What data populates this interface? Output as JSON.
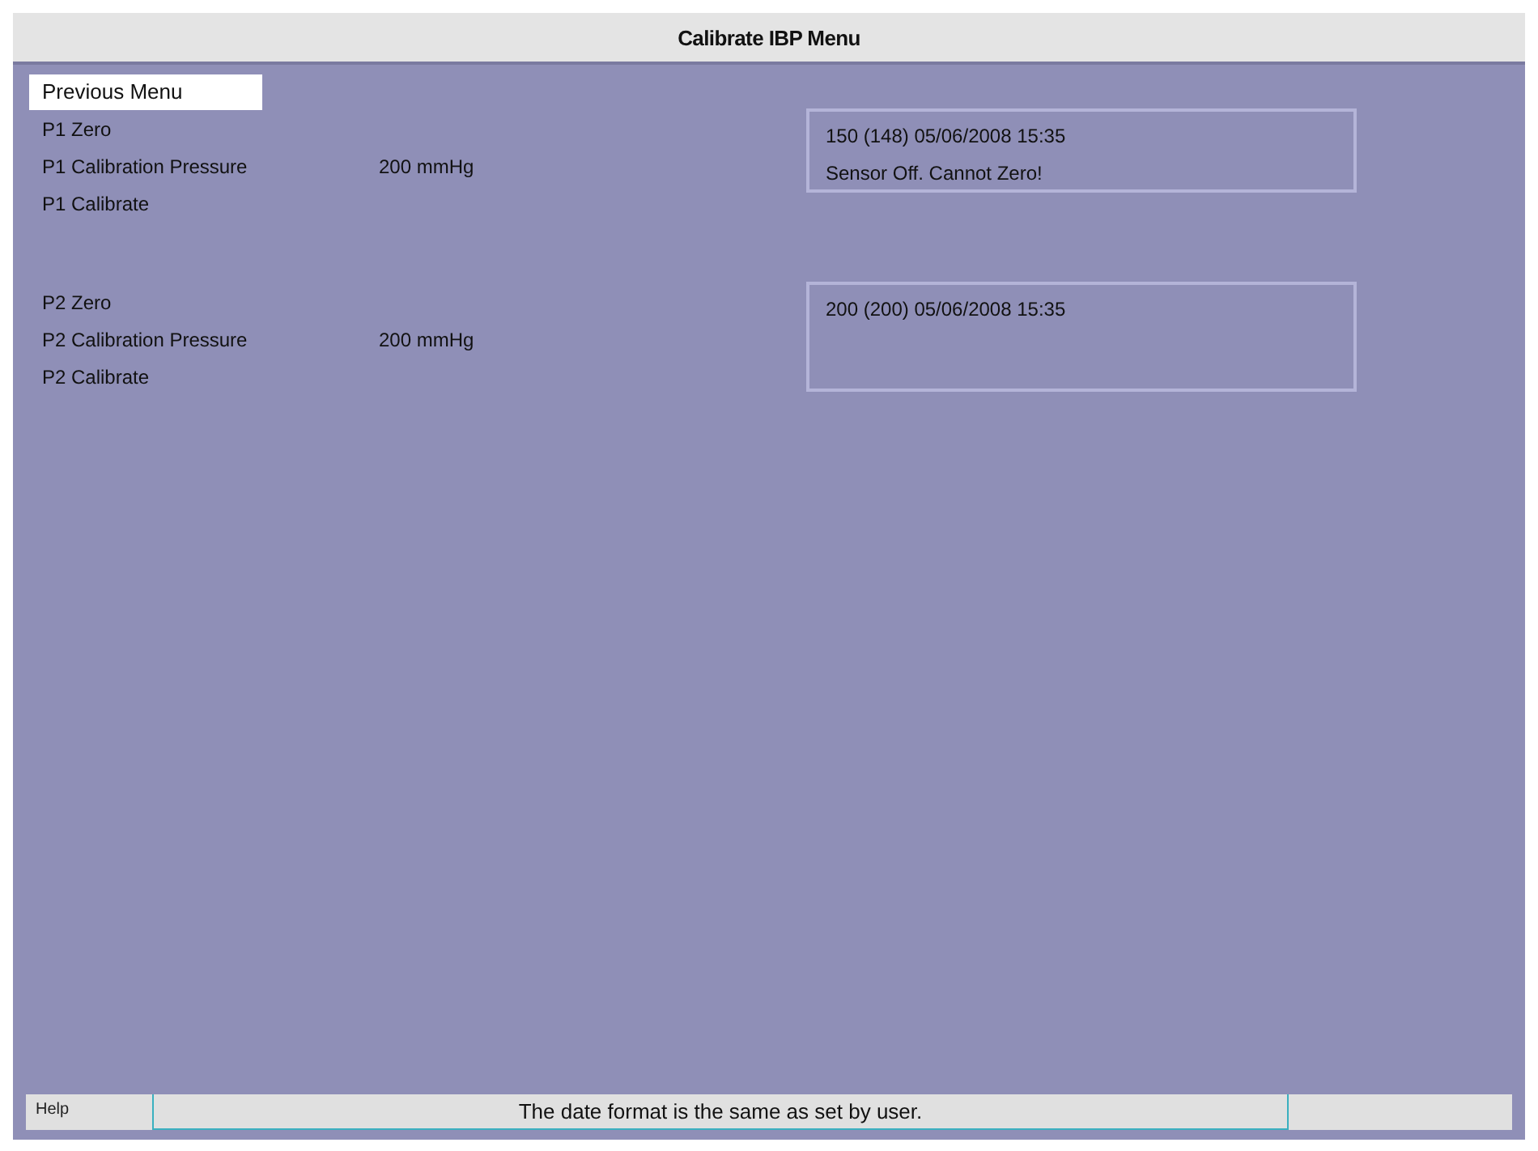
{
  "window": {
    "title": "Calibrate IBP Menu"
  },
  "previous_menu": {
    "label": "Previous Menu",
    "selected": true
  },
  "groups": [
    {
      "items": [
        {
          "label": "P1 Zero",
          "selected": false
        },
        {
          "label": "P1 Calibration Pressure",
          "value": "200 mmHg",
          "selected": false
        },
        {
          "label": "P1 Calibrate",
          "selected": false
        }
      ],
      "status_lines": [
        "150 (148) 05/06/2008 15:35",
        "Sensor Off. Cannot Zero!"
      ]
    },
    {
      "items": [
        {
          "label": "P2 Zero",
          "selected": false
        },
        {
          "label": "P2 Calibration Pressure",
          "value": "200 mmHg",
          "selected": false
        },
        {
          "label": "P2 Calibrate",
          "selected": false
        }
      ],
      "status_lines": [
        "200 (200) 05/06/2008 15:35"
      ]
    }
  ],
  "help_bar": {
    "label": "Help",
    "message": "The date format is the same as set by user."
  }
}
